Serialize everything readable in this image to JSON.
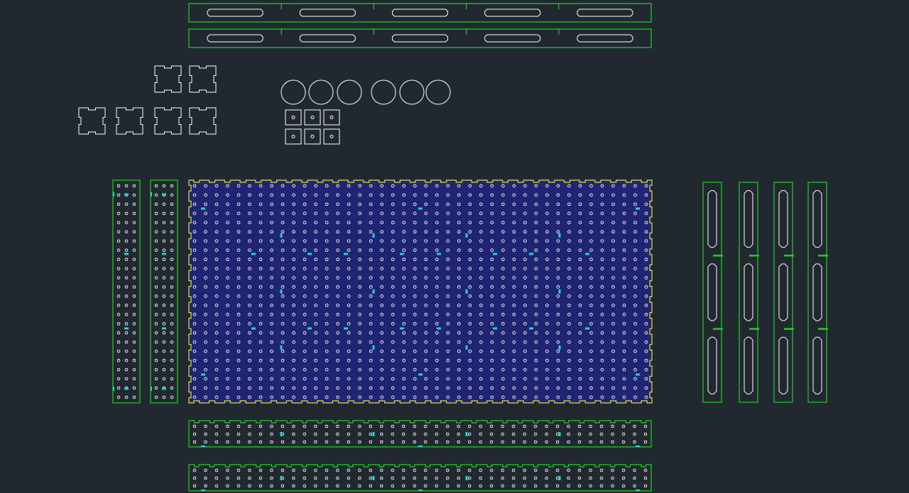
{
  "canvas": {
    "background": "#212830"
  },
  "layers": {
    "outline": "#1fd11f",
    "cut": "#ffffff",
    "panel_outline": "#e2e22a",
    "panel_fill": "#1f2473",
    "marker": "#22d3d3",
    "hole": "#ffffff"
  },
  "parts": {
    "top_rails": {
      "count": 2,
      "slots_per_rail": 5
    },
    "square_tabs": {
      "count": 6
    },
    "discs": {
      "count": 6
    },
    "small_squares": {
      "count": 6
    },
    "side_strips": {
      "count": 2,
      "hole_columns": 3,
      "hole_rows": 24
    },
    "main_panel": {
      "hole_columns": 42,
      "hole_rows": 24
    },
    "vertical_rails": {
      "count": 4,
      "slots_per_rail": 3
    },
    "bottom_strips": {
      "count": 2,
      "hole_columns": 42,
      "hole_rows": 3
    }
  }
}
